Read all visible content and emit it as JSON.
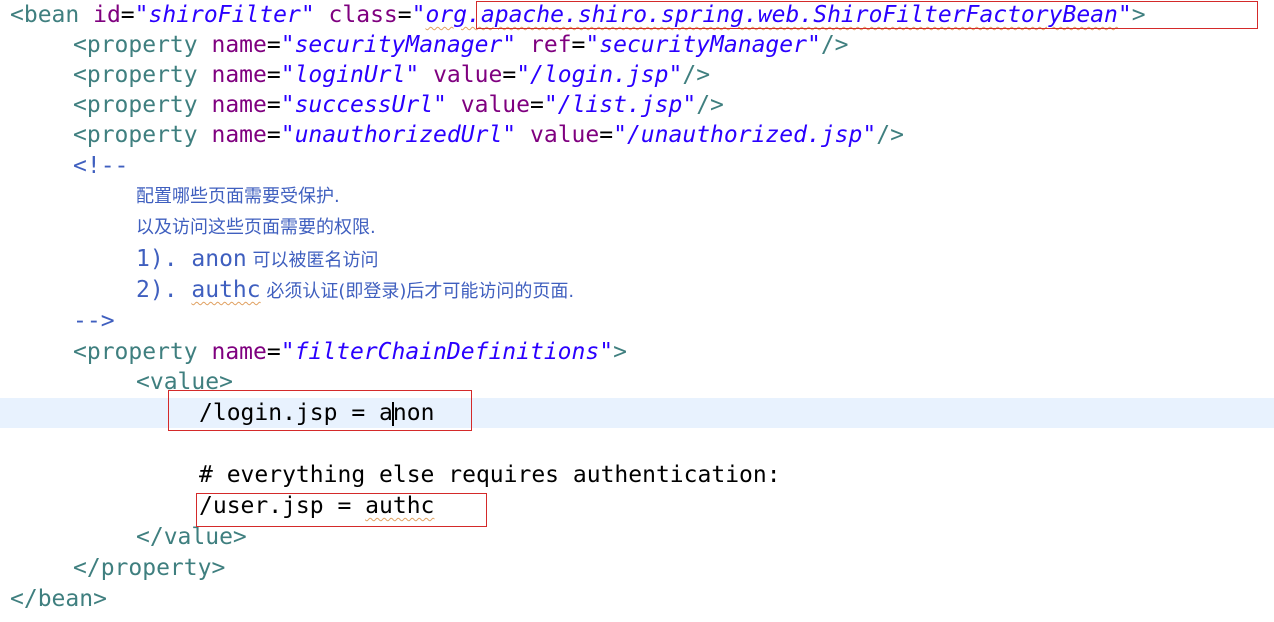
{
  "code": {
    "l1": {
      "open": "<bean ",
      "a1": "id",
      "eq1": "=",
      "v1": "\"shiroFilter\"",
      "sp1": " ",
      "a2": "class",
      "eq2": "=",
      "q1": "\"",
      "v2": "org.apache.shiro.spring.web.ShiroFilterFactoryBean",
      "q2": "\"",
      "close": ">"
    },
    "l2": {
      "open": "<property ",
      "a1": "name",
      "eq1": "=",
      "v1": "\"securityManager\"",
      "sp": " ",
      "a2": "ref",
      "eq2": "=",
      "v2": "\"securityManager\"",
      "close": "/>"
    },
    "l3": {
      "open": "<property ",
      "a1": "name",
      "eq1": "=",
      "v1": "\"loginUrl\"",
      "sp": " ",
      "a2": "value",
      "eq2": "=",
      "v2": "\"/login.jsp\"",
      "close": "/>"
    },
    "l4": {
      "open": "<property ",
      "a1": "name",
      "eq1": "=",
      "v1": "\"successUrl\"",
      "sp": " ",
      "a2": "value",
      "eq2": "=",
      "v2": "\"/list.jsp\"",
      "close": "/>"
    },
    "l5": {
      "open": "<property ",
      "a1": "name",
      "eq1": "=",
      "v1": "\"unauthorizedUrl\"",
      "sp": " ",
      "a2": "value",
      "eq2": "=",
      "v2": "\"/unauthorized.jsp\"",
      "close": "/>"
    },
    "l6": "<!--",
    "l7": "配置哪些页面需要受保护.",
    "l8": "以及访问这些页面需要的权限.",
    "l9": {
      "num": "1). ",
      "kw": "anon",
      "txt": " 可以被匿名访问"
    },
    "l10": {
      "num": "2). ",
      "kw": "authc",
      "txt": " 必须认证(即登录)后才可能访问的页面."
    },
    "l11": "-->",
    "l12": {
      "open": "<property ",
      "a1": "name",
      "eq1": "=",
      "v1": "\"filterChainDefinitions\"",
      "close": ">"
    },
    "l13": "<value>",
    "l14": {
      "pre": "/login.jsp = a",
      "post": "non"
    },
    "l16": "# everything else requires authentication:",
    "l17": {
      "pre": "/user.jsp = ",
      "kw": "authc"
    },
    "l18": "</value>",
    "l19": "</property>",
    "l20": "</bean>"
  },
  "colors": {
    "tag": "#3f7f7f",
    "attribute": "#7f007f",
    "string": "#2a00ff",
    "comment": "#3f5fbf",
    "current_line": "#e8f2fe",
    "annotation_box": "#d42a2a",
    "spell_squiggle": "#e0a060"
  }
}
